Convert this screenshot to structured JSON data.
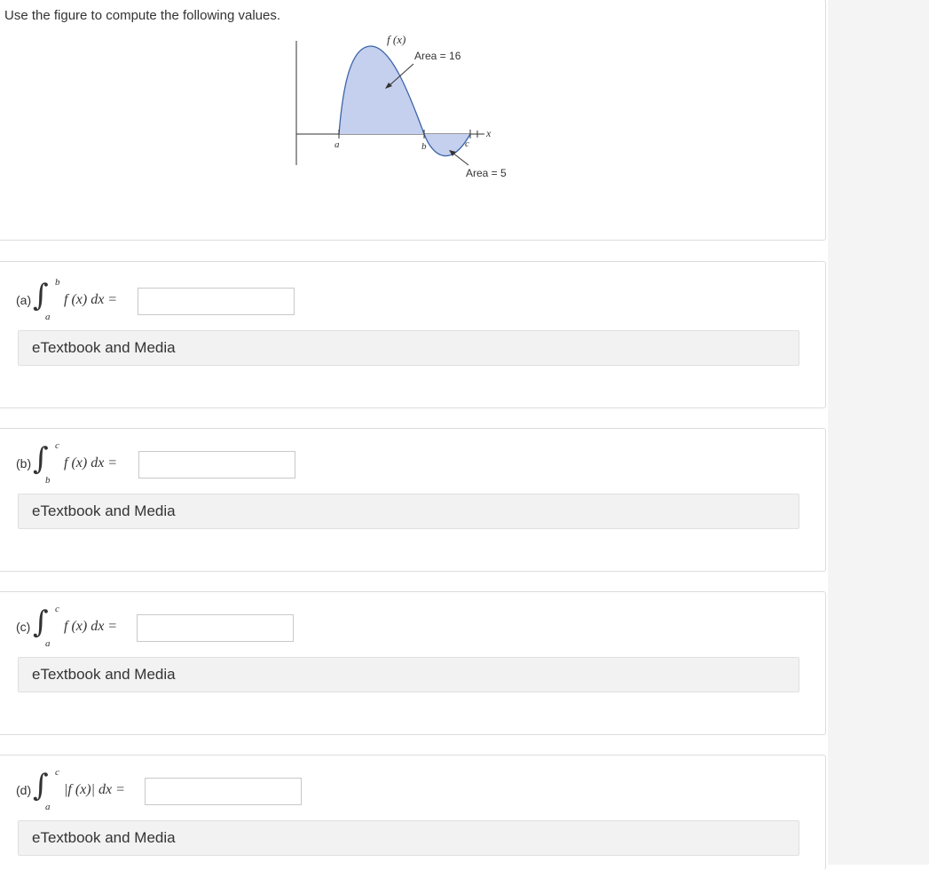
{
  "intro": "Use the figure to compute the following values.",
  "figure": {
    "function_label": "f (x)",
    "area_label_top": "Area = 16",
    "area_label_bottom": "Area = 5",
    "x_axis_label": "x",
    "point_a": "a",
    "point_b": "b",
    "point_c": "c",
    "fill_color": "#c5cfee",
    "curve_color": "#3b64a8"
  },
  "questions": [
    {
      "label": "(a)",
      "upper": "b",
      "lower": "a",
      "expr": "f (x) dx =",
      "value": "",
      "media": "eTextbook and Media"
    },
    {
      "label": "(b)",
      "upper": "c",
      "lower": "b",
      "expr": "f (x) dx =",
      "value": "",
      "media": "eTextbook and Media"
    },
    {
      "label": "(c)",
      "upper": "c",
      "lower": "a",
      "expr": "f (x) dx =",
      "value": "",
      "media": "eTextbook and Media"
    },
    {
      "label": "(d)",
      "upper": "c",
      "lower": "a",
      "expr": "|f (x)| dx =",
      "value": "",
      "media": "eTextbook and Media"
    }
  ]
}
